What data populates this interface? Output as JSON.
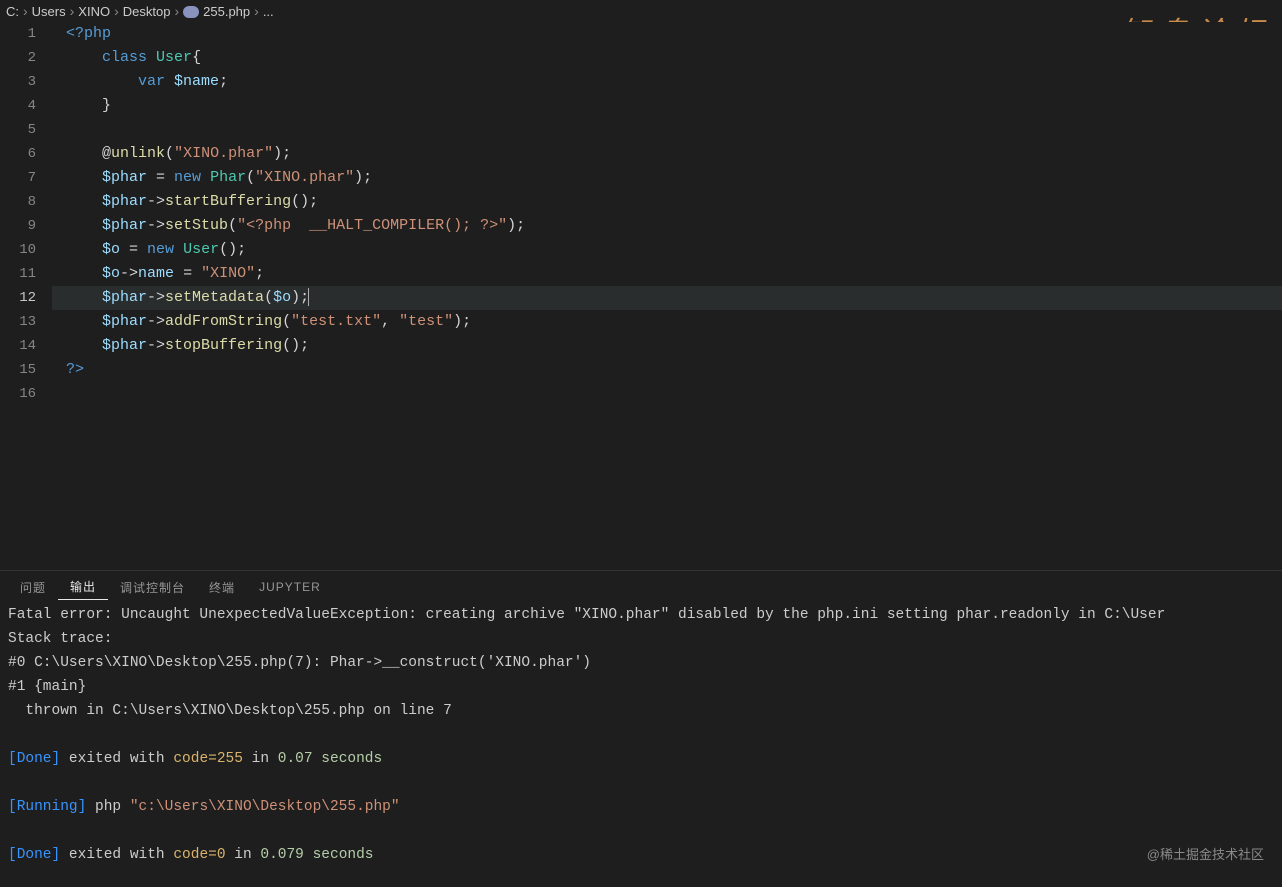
{
  "breadcrumb": {
    "items": [
      "C:",
      "Users",
      "XINO",
      "Desktop",
      "255.php",
      "..."
    ]
  },
  "watermark_top": "知鸟论坛",
  "watermark_bottom": "@稀土掘金技术社区",
  "editor": {
    "active_line": 12,
    "lines": [
      {
        "n": 1,
        "tokens": [
          {
            "t": "<?php",
            "c": "k-tag"
          }
        ]
      },
      {
        "n": 2,
        "indent": 1,
        "tokens": [
          {
            "t": "class",
            "c": "k-class"
          },
          {
            "t": " "
          },
          {
            "t": "User",
            "c": "cls"
          },
          {
            "t": "{",
            "c": "punct"
          }
        ]
      },
      {
        "n": 3,
        "indent": 2,
        "tokens": [
          {
            "t": "var",
            "c": "k-var"
          },
          {
            "t": " "
          },
          {
            "t": "$name",
            "c": "var"
          },
          {
            "t": ";",
            "c": "punct"
          }
        ]
      },
      {
        "n": 4,
        "indent": 1,
        "tokens": [
          {
            "t": "}",
            "c": "punct"
          }
        ]
      },
      {
        "n": 5,
        "tokens": []
      },
      {
        "n": 6,
        "indent": 1,
        "tokens": [
          {
            "t": "@",
            "c": "punct"
          },
          {
            "t": "unlink",
            "c": "fn"
          },
          {
            "t": "(",
            "c": "punct"
          },
          {
            "t": "\"XINO.phar\"",
            "c": "str"
          },
          {
            "t": ");",
            "c": "punct"
          }
        ]
      },
      {
        "n": 7,
        "indent": 1,
        "tokens": [
          {
            "t": "$phar",
            "c": "var"
          },
          {
            "t": " = ",
            "c": "op"
          },
          {
            "t": "new",
            "c": "k-new"
          },
          {
            "t": " "
          },
          {
            "t": "Phar",
            "c": "cls"
          },
          {
            "t": "(",
            "c": "punct"
          },
          {
            "t": "\"XINO.phar\"",
            "c": "str"
          },
          {
            "t": ");",
            "c": "punct"
          }
        ]
      },
      {
        "n": 8,
        "indent": 1,
        "tokens": [
          {
            "t": "$phar",
            "c": "var"
          },
          {
            "t": "->",
            "c": "arrow"
          },
          {
            "t": "startBuffering",
            "c": "fn"
          },
          {
            "t": "();",
            "c": "punct"
          }
        ]
      },
      {
        "n": 9,
        "indent": 1,
        "tokens": [
          {
            "t": "$phar",
            "c": "var"
          },
          {
            "t": "->",
            "c": "arrow"
          },
          {
            "t": "setStub",
            "c": "fn"
          },
          {
            "t": "(",
            "c": "punct"
          },
          {
            "t": "\"<?php  __HALT_COMPILER(); ?>\"",
            "c": "str"
          },
          {
            "t": ");",
            "c": "punct"
          }
        ]
      },
      {
        "n": 10,
        "indent": 1,
        "tokens": [
          {
            "t": "$o",
            "c": "var"
          },
          {
            "t": " = ",
            "c": "op"
          },
          {
            "t": "new",
            "c": "k-new"
          },
          {
            "t": " "
          },
          {
            "t": "User",
            "c": "cls"
          },
          {
            "t": "();",
            "c": "punct"
          }
        ]
      },
      {
        "n": 11,
        "indent": 1,
        "tokens": [
          {
            "t": "$o",
            "c": "var"
          },
          {
            "t": "->",
            "c": "arrow"
          },
          {
            "t": "name",
            "c": "var"
          },
          {
            "t": " = ",
            "c": "op"
          },
          {
            "t": "\"XINO\"",
            "c": "str"
          },
          {
            "t": ";",
            "c": "punct"
          }
        ]
      },
      {
        "n": 12,
        "indent": 1,
        "tokens": [
          {
            "t": "$phar",
            "c": "var"
          },
          {
            "t": "->",
            "c": "arrow"
          },
          {
            "t": "setMetadata",
            "c": "fn"
          },
          {
            "t": "(",
            "c": "punct"
          },
          {
            "t": "$o",
            "c": "var"
          },
          {
            "t": ");",
            "c": "punct"
          }
        ],
        "cursor": true
      },
      {
        "n": 13,
        "indent": 1,
        "tokens": [
          {
            "t": "$phar",
            "c": "var"
          },
          {
            "t": "->",
            "c": "arrow"
          },
          {
            "t": "addFromString",
            "c": "fn"
          },
          {
            "t": "(",
            "c": "punct"
          },
          {
            "t": "\"test.txt\"",
            "c": "str"
          },
          {
            "t": ", ",
            "c": "punct"
          },
          {
            "t": "\"test\"",
            "c": "str"
          },
          {
            "t": ");",
            "c": "punct"
          }
        ]
      },
      {
        "n": 14,
        "indent": 1,
        "tokens": [
          {
            "t": "$phar",
            "c": "var"
          },
          {
            "t": "->",
            "c": "arrow"
          },
          {
            "t": "stopBuffering",
            "c": "fn"
          },
          {
            "t": "();",
            "c": "punct"
          }
        ]
      },
      {
        "n": 15,
        "tokens": [
          {
            "t": "?>",
            "c": "k-tag"
          }
        ]
      },
      {
        "n": 16,
        "tokens": []
      }
    ]
  },
  "panel": {
    "tabs": [
      "问题",
      "输出",
      "调试控制台",
      "终端",
      "JUPYTER"
    ],
    "active_tab": 1,
    "output": [
      {
        "segs": [
          {
            "t": "Fatal error: Uncaught UnexpectedValueException: creating archive \"XINO.phar\" disabled by the php.ini setting phar.readonly in C:\\User"
          }
        ]
      },
      {
        "segs": [
          {
            "t": "Stack trace:"
          }
        ]
      },
      {
        "segs": [
          {
            "t": "#0 C:\\Users\\XINO\\Desktop\\255.php(7): Phar->__construct('XINO.phar')"
          }
        ]
      },
      {
        "segs": [
          {
            "t": "#1 {main}"
          }
        ]
      },
      {
        "segs": [
          {
            "t": "  thrown in C:\\Users\\XINO\\Desktop\\255.php on line 7"
          }
        ]
      },
      {
        "segs": [
          {
            "t": ""
          }
        ]
      },
      {
        "segs": [
          {
            "t": "[Done]",
            "c": "out-blue"
          },
          {
            "t": " exited with "
          },
          {
            "t": "code=255",
            "c": "out-warn"
          },
          {
            "t": " in "
          },
          {
            "t": "0.07",
            "c": "out-num"
          },
          {
            "t": " "
          },
          {
            "t": "seconds",
            "c": "out-num"
          }
        ]
      },
      {
        "segs": [
          {
            "t": ""
          }
        ]
      },
      {
        "segs": [
          {
            "t": "[Running]",
            "c": "out-blue"
          },
          {
            "t": " php "
          },
          {
            "t": "\"c:\\Users\\XINO\\Desktop\\255.php\"",
            "c": "out-str"
          }
        ]
      },
      {
        "segs": [
          {
            "t": ""
          }
        ]
      },
      {
        "segs": [
          {
            "t": "[Done]",
            "c": "out-blue"
          },
          {
            "t": " exited with "
          },
          {
            "t": "code=0",
            "c": "out-warn"
          },
          {
            "t": " in "
          },
          {
            "t": "0.079",
            "c": "out-num"
          },
          {
            "t": " "
          },
          {
            "t": "seconds",
            "c": "out-num"
          }
        ]
      }
    ]
  }
}
